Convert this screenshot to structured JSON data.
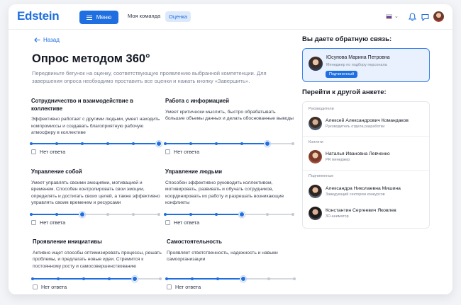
{
  "header": {
    "logo": "Edstein",
    "menu_label": "Меню",
    "nav": [
      "Моя команда",
      "Оценка"
    ]
  },
  "back_label": "Назад",
  "title": "Опрос методом 360°",
  "subtitle": "Передвиньте бегунок на оценку, соответствующую проявлению выбранной компетенции. Для завершения опроса необходимо проставить все оценки и нажать кнопку «Завершить».",
  "no_answer_label": "Нет ответа",
  "competencies": [
    {
      "title": "Сотрудничество и взаимодействие в коллективе",
      "desc": "Эффективно работает с другими людьми, умеет находить компромиссы и создавать благоприятную рабочую атмосферу в коллективе",
      "value": 5,
      "max": 5
    },
    {
      "title": "Работа с информацией",
      "desc": "Умеет критически мыслить, быстро обрабатывать большие объемы данных и делать обоснованные выводы",
      "value": 4,
      "max": 5
    },
    {
      "title": "Управление собой",
      "desc": "Умеет управлять своими эмоциями, мотивацией и временем. Способен контролировать свои эмоции, определять и достигать своих целей, а также эффективно управлять своим временем и ресурсами",
      "value": 2,
      "max": 5
    },
    {
      "title": "Управление людьми",
      "desc": "Способен эффективно руководить коллективом, мотивировать, развивать и обучать сотрудников, координировать их работу и разрешать возникающие конфликты",
      "value": 3,
      "max": 5
    },
    {
      "title": "Проявление инициативы",
      "desc": "Активно ищет способы оптимизировать процессы, решать проблемы, и предлагать новые идеи. Стремится к постоянному росту и самосовершенствованию",
      "value": 4,
      "max": 5
    },
    {
      "title": "Самостоятельность",
      "desc": "Проявляет ответственность, надежность и навыки самоорганизации",
      "value": 3,
      "max": 5
    }
  ],
  "feedback": {
    "heading": "Вы даете обратную связь:",
    "name": "Юсупова Марина Петровна",
    "role": "Менеджер по подбору персонала",
    "badge": "Подчиненный"
  },
  "switch": {
    "heading": "Перейти к другой анкете:",
    "groups": [
      {
        "label": "Руководители",
        "people": [
          {
            "name": "Алексей Александрович Командаков",
            "role": "Руководитель отдела разработки"
          }
        ]
      },
      {
        "label": "Коллеги",
        "people": [
          {
            "name": "Наталья Ивановна Левченко",
            "role": "PR менеджер"
          }
        ]
      },
      {
        "label": "Подчиненные",
        "people": [
          {
            "name": "Александра Николаевна Мишина",
            "role": "Заведующий сектором конкурсов"
          },
          {
            "name": "Константин Сергеевич Яковлев",
            "role": "3D-аниматор"
          }
        ]
      }
    ]
  },
  "colors": {
    "accent": "#1f6fe0",
    "accent_light": "#e8f1fd"
  }
}
